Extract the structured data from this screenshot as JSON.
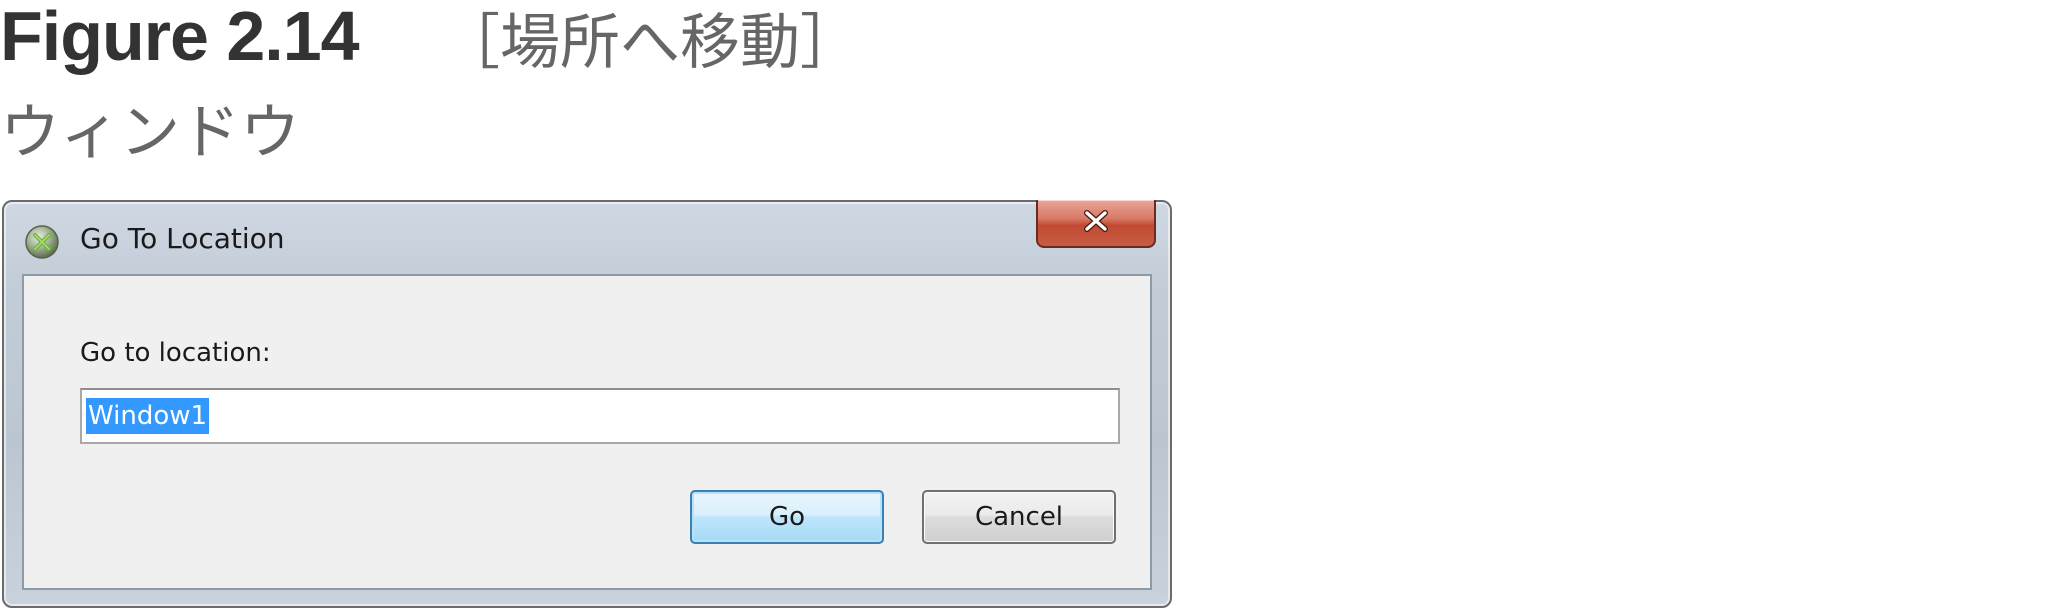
{
  "caption": {
    "figure_label": "Figure 2.14",
    "title_part1": "［場所へ移動］",
    "title_part2": "ウィンドウ"
  },
  "dialog": {
    "title": "Go To Location",
    "app_icon": "eclipse-style-app-icon",
    "close_icon": "close-x-icon",
    "field_label": "Go to location:",
    "input_value": "Window1",
    "go_label": "Go",
    "cancel_label": "Cancel"
  },
  "colors": {
    "selection": "#3399ff",
    "close_button": "#c75c45",
    "default_button_border": "#3c7fb1"
  }
}
